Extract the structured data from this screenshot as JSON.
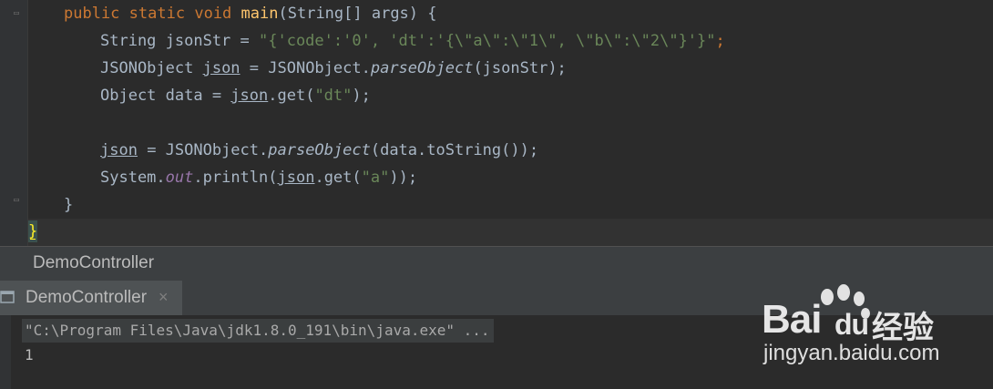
{
  "editor": {
    "lines": {
      "l1": {
        "kw1": "public",
        "kw2": "static",
        "kw3": "void",
        "fn": "main",
        "rest": "(String[] args) {"
      },
      "l2": {
        "pre": "String jsonStr = ",
        "str": "\"{'code':'0', 'dt':'{\\\"a\\\":\\\"1\\\", \\\"b\\\":\\\"2\\\"}'}\"",
        "end": ";"
      },
      "l3": {
        "a": "JSONObject ",
        "var": "json",
        "b": " = JSONObject.",
        "m": "parseObject",
        "c": "(jsonStr);"
      },
      "l4": {
        "a": "Object data = ",
        "var": "json",
        "b": ".get(",
        "str": "\"dt\"",
        "c": ");"
      },
      "l5": {
        "var": "json",
        "a": " = JSONObject.",
        "m": "parseObject",
        "b": "(data.toString());"
      },
      "l6": {
        "a": "System.",
        "fld": "out",
        "b": ".println(",
        "var": "json",
        "c": ".get(",
        "str": "\"a\"",
        "d": "));"
      },
      "l7": "}",
      "l8": "}"
    }
  },
  "breadcrumb": {
    "label": "DemoController"
  },
  "run_panel": {
    "tab_label": "DemoController",
    "close_glyph": "×"
  },
  "console": {
    "command": "\"C:\\Program Files\\Java\\jdk1.8.0_191\\bin\\java.exe\" ...",
    "output": "1"
  },
  "watermark": {
    "brand": "Bai du",
    "brand_left": "Bai",
    "brand_right": "du",
    "cn": "经验",
    "url": "jingyan.baidu.com"
  }
}
